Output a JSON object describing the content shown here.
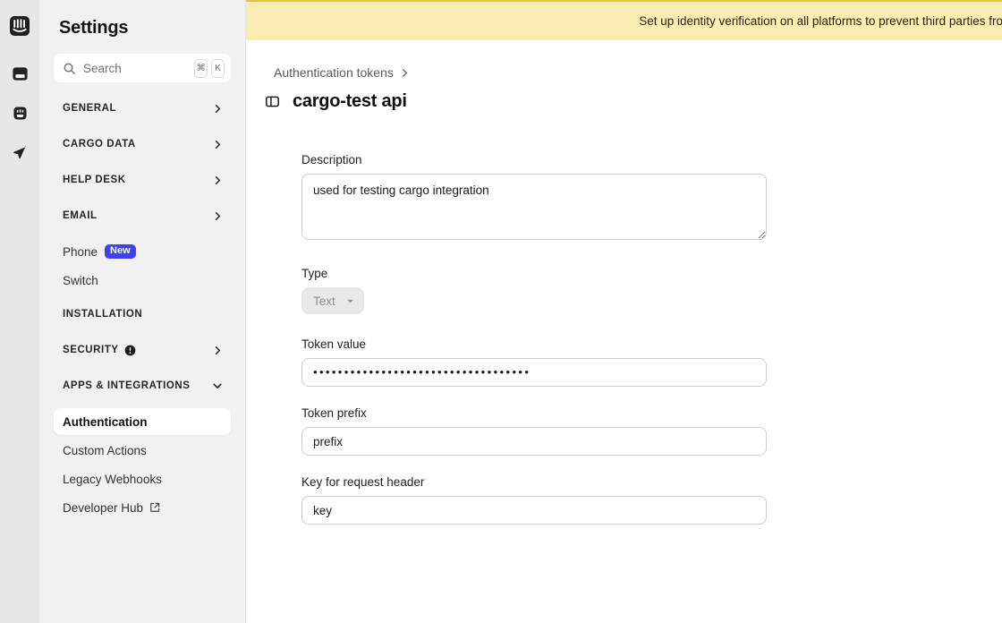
{
  "rail": {
    "logo": "intercom-logo",
    "items": [
      {
        "icon": "inbox-icon",
        "name": "inbox"
      },
      {
        "icon": "fin-face-icon",
        "name": "fin-ai"
      },
      {
        "icon": "paper-plane-icon",
        "name": "outbound"
      }
    ]
  },
  "sidebar": {
    "title": "Settings",
    "search": {
      "placeholder": "Search",
      "icon": "search-icon",
      "shortcut": [
        "⌘",
        "K"
      ]
    },
    "nav": [
      {
        "type": "section",
        "label": "GENERAL",
        "expanded": false,
        "chevron": "chevron-right-icon"
      },
      {
        "type": "section",
        "label": "CARGO DATA",
        "expanded": false,
        "chevron": "chevron-right-icon"
      },
      {
        "type": "section",
        "label": "HELP DESK",
        "expanded": false,
        "chevron": "chevron-right-icon"
      },
      {
        "type": "section",
        "label": "EMAIL",
        "expanded": false,
        "chevron": "chevron-right-icon"
      },
      {
        "type": "item",
        "label": "Phone",
        "badge": "New",
        "active": false
      },
      {
        "type": "item",
        "label": "Switch",
        "active": false
      },
      {
        "type": "section",
        "label": "INSTALLATION",
        "expanded": false,
        "chevron": ""
      },
      {
        "type": "section",
        "label": "SECURITY",
        "expanded": false,
        "chevron": "chevron-right-icon",
        "warning": "alert-circle-icon"
      },
      {
        "type": "section",
        "label": "APPS & INTEGRATIONS",
        "expanded": true,
        "chevron": "chevron-down-icon"
      },
      {
        "type": "item",
        "label": "Authentication",
        "active": true
      },
      {
        "type": "item",
        "label": "Custom Actions",
        "active": false
      },
      {
        "type": "item",
        "label": "Legacy Webhooks",
        "active": false
      },
      {
        "type": "item",
        "label": "Developer Hub",
        "active": false,
        "external": "external-link-icon"
      }
    ]
  },
  "banner": {
    "text": "Set up identity verification on all platforms to prevent third parties from impersonating",
    "background": "#fbecb4",
    "border": "#e8c32f"
  },
  "main": {
    "breadcrumb": {
      "label": "Authentication tokens",
      "chevron": "chevron-right-icon"
    },
    "page_title": "cargo-test api",
    "title_icon": "panel-toggle-icon",
    "form": {
      "description": {
        "label": "Description",
        "value": "used for testing cargo integration"
      },
      "type": {
        "label": "Type",
        "value": "Text",
        "caret": "chevron-down-icon",
        "disabled": true
      },
      "token_value": {
        "label": "Token value",
        "value": "•••••••••••••••••••••••••••••••••••"
      },
      "token_prefix": {
        "label": "Token prefix",
        "value": "prefix"
      },
      "request_header_key": {
        "label": "Key for request header",
        "value": "key"
      }
    }
  },
  "colors": {
    "rail_bg": "#e7e7e7",
    "sidebar_bg": "#f1f1f1",
    "accent_badge": "#3d41f2",
    "banner_bg": "#fbecb4"
  }
}
